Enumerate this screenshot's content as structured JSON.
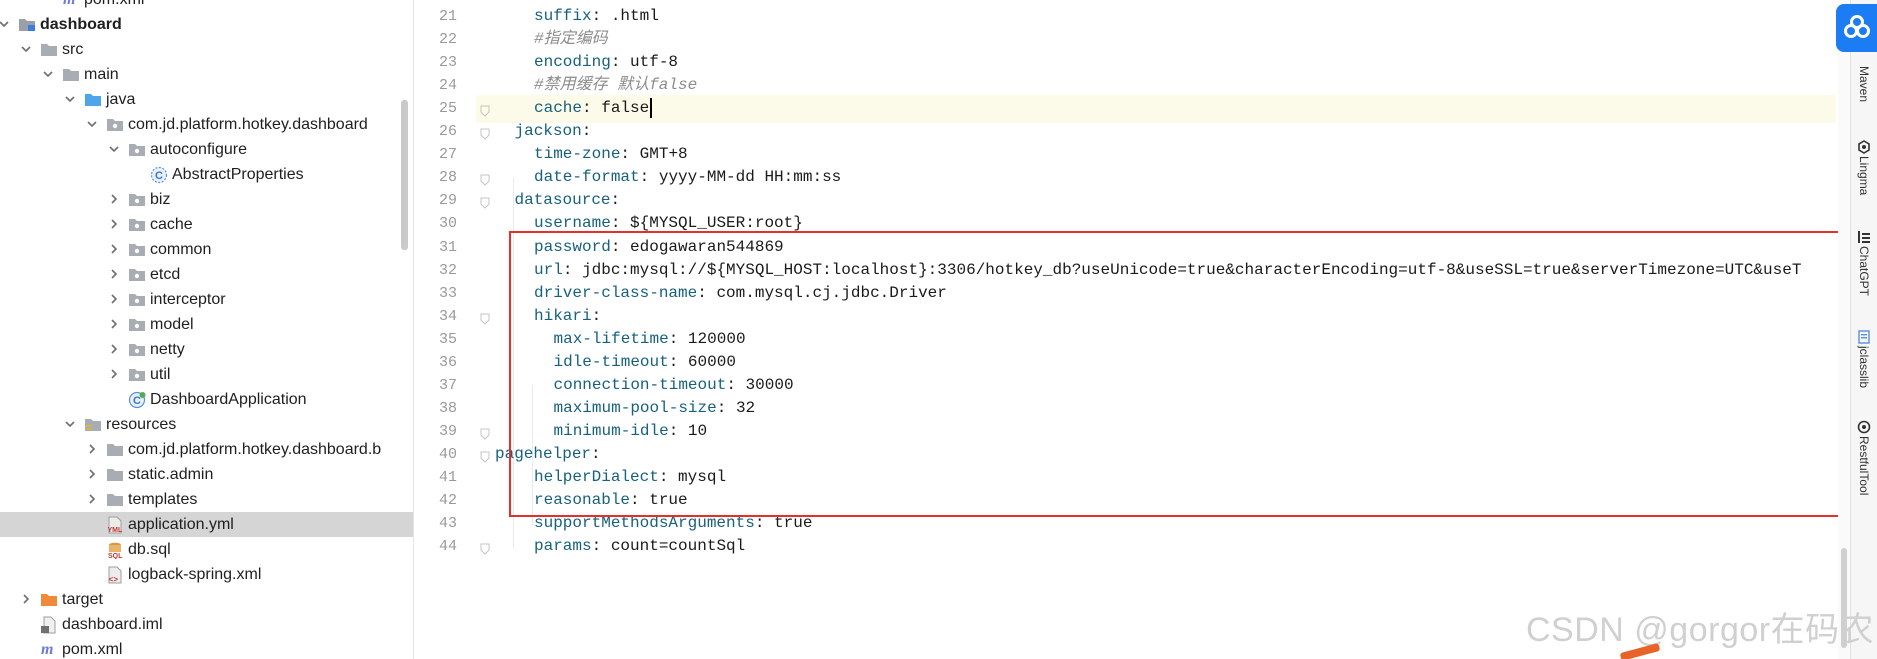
{
  "project_tree": {
    "items": [
      {
        "label": "pom.xml",
        "icon": "maven-icon"
      },
      {
        "label": "dashboard",
        "icon": "module-folder-icon"
      },
      {
        "label": "src",
        "icon": "folder-icon"
      },
      {
        "label": "main",
        "icon": "folder-icon"
      },
      {
        "label": "java",
        "icon": "source-folder-icon"
      },
      {
        "label": "com.jd.platform.hotkey.dashboard",
        "icon": "package-icon"
      },
      {
        "label": "autoconfigure",
        "icon": "package-icon"
      },
      {
        "label": "AbstractProperties",
        "icon": "abstract-class-icon"
      },
      {
        "label": "biz",
        "icon": "package-icon"
      },
      {
        "label": "cache",
        "icon": "package-icon"
      },
      {
        "label": "common",
        "icon": "package-icon"
      },
      {
        "label": "etcd",
        "icon": "package-icon"
      },
      {
        "label": "interceptor",
        "icon": "package-icon"
      },
      {
        "label": "model",
        "icon": "package-icon"
      },
      {
        "label": "netty",
        "icon": "package-icon"
      },
      {
        "label": "util",
        "icon": "package-icon"
      },
      {
        "label": "DashboardApplication",
        "icon": "spring-class-icon"
      },
      {
        "label": "resources",
        "icon": "resources-folder-icon"
      },
      {
        "label": "com.jd.platform.hotkey.dashboard.b",
        "icon": "folder-icon"
      },
      {
        "label": "static.admin",
        "icon": "folder-icon"
      },
      {
        "label": "templates",
        "icon": "folder-icon"
      },
      {
        "label": "application.yml",
        "icon": "yml-file-icon"
      },
      {
        "label": "db.sql",
        "icon": "sql-file-icon"
      },
      {
        "label": "logback-spring.xml",
        "icon": "xml-file-icon"
      },
      {
        "label": "target",
        "icon": "excluded-folder-icon"
      },
      {
        "label": "dashboard.iml",
        "icon": "iml-file-icon"
      },
      {
        "label": "pom.xml",
        "icon": "maven-icon"
      }
    ],
    "selected": "application.yml"
  },
  "editor": {
    "lines": [
      {
        "num": "21",
        "key": "suffix",
        "value": " .html"
      },
      {
        "num": "22",
        "comment": "#指定编码"
      },
      {
        "num": "23",
        "key": "encoding",
        "value": " utf-8"
      },
      {
        "num": "24",
        "comment": "#禁用缓存 默认false"
      },
      {
        "num": "25",
        "key": "cache",
        "value": " false"
      },
      {
        "num": "26",
        "key": "jackson",
        "value": ""
      },
      {
        "num": "27",
        "key": "time-zone",
        "value": " GMT+8"
      },
      {
        "num": "28",
        "key": "date-format",
        "value": " yyyy-MM-dd HH:mm:ss"
      },
      {
        "num": "29",
        "key": "datasource",
        "value": ""
      },
      {
        "num": "30",
        "key": "username",
        "value": " ${MYSQL_USER:root}"
      },
      {
        "num": "31",
        "key": "password",
        "value": " edogawaran544869"
      },
      {
        "num": "32",
        "key": "url",
        "value": " jdbc:mysql://${MYSQL_HOST:localhost}:3306/hotkey_db?useUnicode=true&characterEncoding=utf-8&useSSL=true&serverTimezone=UTC&useT"
      },
      {
        "num": "33",
        "key": "driver-class-name",
        "value": " com.mysql.cj.jdbc.Driver"
      },
      {
        "num": "34",
        "key": "hikari",
        "value": ""
      },
      {
        "num": "35",
        "key": "max-lifetime",
        "value": " 120000"
      },
      {
        "num": "36",
        "key": "idle-timeout",
        "value": " 60000"
      },
      {
        "num": "37",
        "key": "connection-timeout",
        "value": " 30000"
      },
      {
        "num": "38",
        "key": "maximum-pool-size",
        "value": " 32"
      },
      {
        "num": "39",
        "key": "minimum-idle",
        "value": " 10"
      },
      {
        "num": "40",
        "key": "pagehelper",
        "value": ""
      },
      {
        "num": "41",
        "key": "helperDialect",
        "value": " mysql"
      },
      {
        "num": "42",
        "key": "reasonable",
        "value": " true"
      },
      {
        "num": "43",
        "key": "supportMethodsArguments",
        "value": " true"
      },
      {
        "num": "44",
        "key": "params",
        "value": " count=countSql"
      }
    ],
    "current_line": "25"
  },
  "right_toolbar": {
    "tools": [
      {
        "label": "Maven",
        "icon": "maven-tool-icon"
      },
      {
        "label": "Lingma",
        "icon": "lingma-icon"
      },
      {
        "label": "ChatGPT",
        "icon": "chatgpt-icon"
      },
      {
        "label": "jclasslib",
        "icon": "jclasslib-icon"
      },
      {
        "label": "RestfulTool",
        "icon": "restful-tool-icon"
      }
    ]
  },
  "watermark": "CSDN @gorgor在码农",
  "colors": {
    "yaml_key": "#17617e",
    "comment": "#8c8c8c",
    "highlight_box": "#e4302b",
    "selected_row": "#d5d5d5",
    "current_line": "#fcfae8",
    "badge_blue": "#1c7cf3"
  }
}
